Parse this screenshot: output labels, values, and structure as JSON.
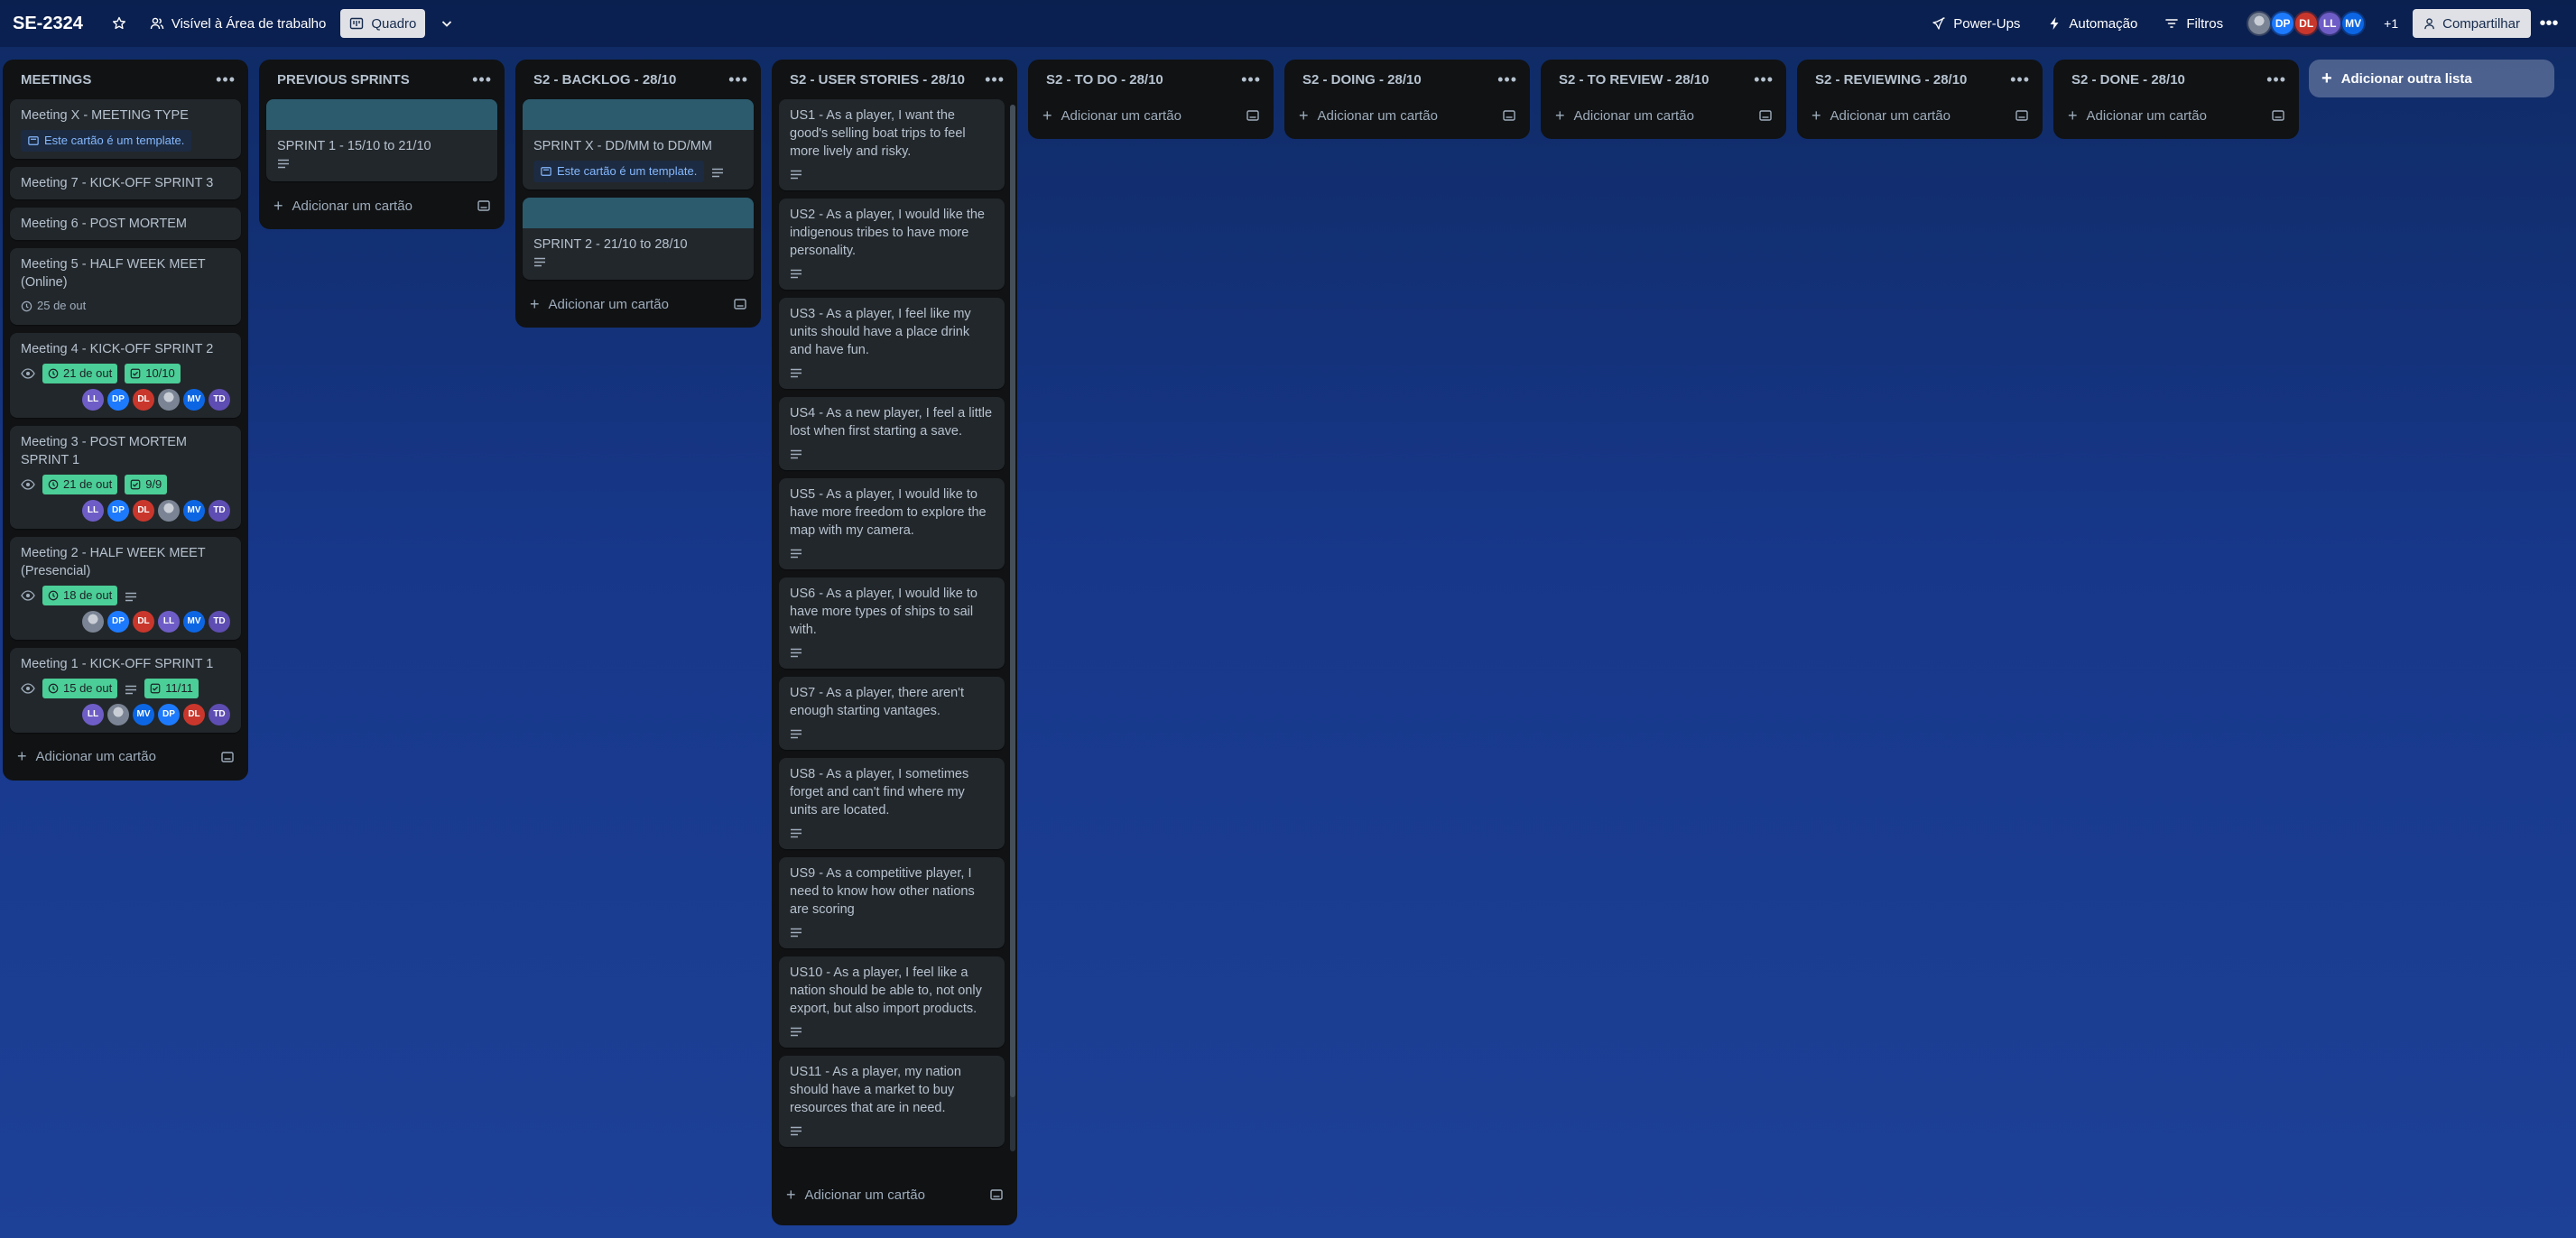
{
  "header": {
    "board_title": "SE-2324",
    "visibility": "Visível à Área de trabalho",
    "view": "Quadro",
    "powerups": "Power-Ups",
    "automation": "Automação",
    "filters": "Filtros",
    "members_extra": "+1",
    "share": "Compartilhar",
    "members": [
      {
        "initials": "",
        "color": "#8590a2",
        "icon": "photo-avatar"
      },
      {
        "initials": "DP",
        "color": "#1d7afc"
      },
      {
        "initials": "DL",
        "color": "#c9372c"
      },
      {
        "initials": "LL",
        "color": "#6e5dc6"
      },
      {
        "initials": "MV",
        "color": "#0c66e4"
      }
    ]
  },
  "common": {
    "add_card": "Adicionar um cartão",
    "add_list": "Adicionar outra lista",
    "template_badge": "Este cartão é um template."
  },
  "colors": {
    "date_badge": "#4bce97",
    "cover": "#2c5b6e",
    "avatar_LL": "#6e5dc6",
    "avatar_DP": "#1d7afc",
    "avatar_DL": "#c9372c",
    "avatar_MV": "#0c66e4",
    "avatar_TD": "#5e4db2"
  },
  "lists": {
    "meetings": {
      "title": "MEETINGS",
      "cards": [
        {
          "title": "Meeting X - MEETING TYPE"
        },
        {
          "title": "Meeting 7 - KICK-OFF SPRINT 3"
        },
        {
          "title": "Meeting 6 - POST MORTEM"
        },
        {
          "title": "Meeting 5 - HALF WEEK MEET (Online)",
          "date": "25 de out"
        },
        {
          "title": "Meeting 4 - KICK-OFF SPRINT 2",
          "date": "21 de out",
          "checklist": "10/10"
        },
        {
          "title": "Meeting 3 - POST MORTEM SPRINT 1",
          "date": "21 de out",
          "checklist": "9/9"
        },
        {
          "title": "Meeting 2 - HALF WEEK MEET (Presencial)",
          "date": "18 de out"
        },
        {
          "title": "Meeting 1 - KICK-OFF SPRINT 1",
          "date": "15 de out",
          "checklist": "11/11"
        }
      ]
    },
    "previous": {
      "title": "PREVIOUS SPRINTS",
      "cards": [
        {
          "title": "SPRINT 1 - 15/10 to 21/10"
        }
      ]
    },
    "backlog": {
      "title": "S2 - BACKLOG - 28/10",
      "cards": [
        {
          "title": "SPRINT X - DD/MM to DD/MM"
        },
        {
          "title": "SPRINT 2 - 21/10 to 28/10"
        }
      ]
    },
    "stories": {
      "title": "S2 - USER STORIES - 28/10",
      "cards": [
        {
          "title": "US1 - As a player, I want the good's selling boat trips to feel more lively and risky."
        },
        {
          "title": "US2 - As a player, I would like the indigenous tribes to have more personality."
        },
        {
          "title": "US3 - As a player, I feel like my units should have a place drink and have fun."
        },
        {
          "title": "US4 - As a new player, I feel a little lost when first starting a save."
        },
        {
          "title": "US5 - As a player, I would like to have more freedom to explore the map with my camera."
        },
        {
          "title": "US6 - As a player, I would like to have more types of ships to sail with."
        },
        {
          "title": "US7 - As a player, there aren't enough starting vantages."
        },
        {
          "title": "US8 - As a player, I sometimes forget and can't find where my units are located."
        },
        {
          "title": "US9 - As a competitive player, I need to know how other nations are scoring"
        },
        {
          "title": "US10 - As a player, I feel like a nation should be able to, not only export, but also import products."
        },
        {
          "title": "US11 - As a player, my nation should have a market to buy resources that are in need."
        }
      ]
    },
    "todo": {
      "title": "S2 - TO DO - 28/10"
    },
    "doing": {
      "title": "S2 - DOING - 28/10"
    },
    "toreview": {
      "title": "S2 - TO REVIEW - 28/10"
    },
    "reviewing": {
      "title": "S2 - REVIEWING - 28/10"
    },
    "done": {
      "title": "S2 - DONE - 28/10"
    }
  },
  "card_members": {
    "meeting4": [
      "LL",
      "DP",
      "DL",
      "photo",
      "MV",
      "TD"
    ],
    "meeting3": [
      "LL",
      "DP",
      "DL",
      "photo",
      "MV",
      "TD"
    ],
    "meeting2": [
      "photo",
      "DP",
      "DL",
      "LL",
      "MV",
      "TD"
    ],
    "meeting1": [
      "LL",
      "photo",
      "MV",
      "DP",
      "DL",
      "TD"
    ]
  }
}
